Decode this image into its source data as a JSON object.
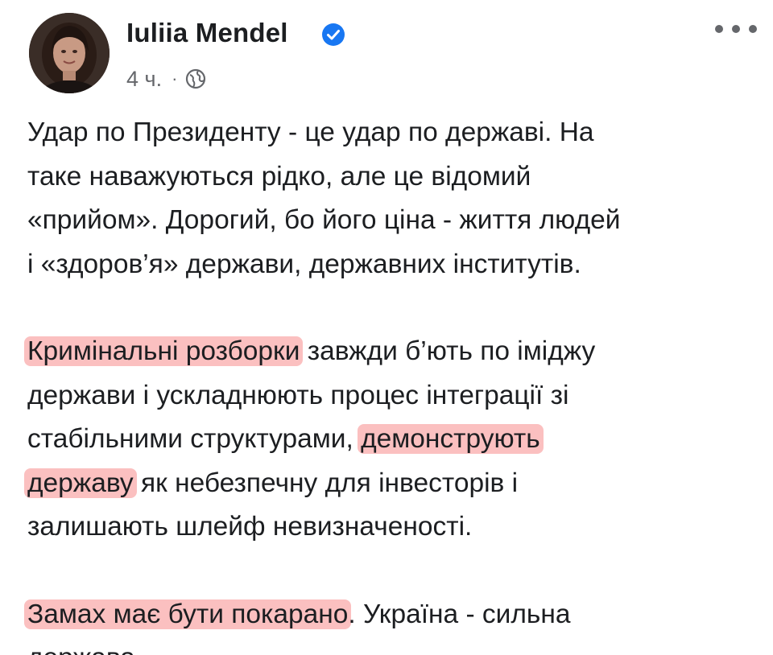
{
  "author": {
    "name": "Iuliia Mendel",
    "verified": true
  },
  "meta": {
    "time": "4 ч.",
    "separator": "·",
    "audience_icon": "globe-icon"
  },
  "more_icon": "more-dots-icon",
  "colors": {
    "highlight": "#f78c8c",
    "verified": "#1877f2",
    "secondary_text": "#65676b"
  },
  "post": {
    "p1": {
      "l1": "Удар по Президенту - це удар по державі. На",
      "l2": "таке наважуються рідко, але це відомий",
      "l3": "«прийом». Дорогий, бо його ціна - життя людей",
      "l4": "і «здоров’я» держави, державних інститутів."
    },
    "p2": {
      "hl1": "Кримінальні розборки",
      "l1_rest": " завжди б’ють по іміджу",
      "l2": "держави і ускладнюють процес інтеграції зі",
      "l3_pre": "стабільними структурами, ",
      "hl2a": "демонструють",
      "hl2b": "державу",
      "l4_rest": " як небезпечну для інвесторів і",
      "l5": "залишають шлейф невизначеності."
    },
    "p3": {
      "hl3": "Замах має бути покарано",
      "l1_rest": ". Україна - сильна",
      "l2": "держава."
    }
  }
}
